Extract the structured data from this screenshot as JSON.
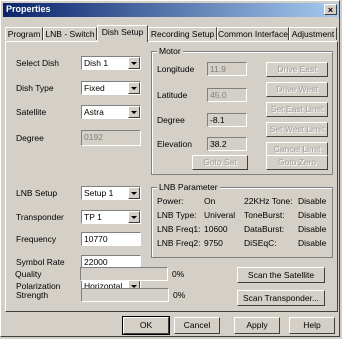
{
  "window": {
    "title": "Properties",
    "close_glyph": "×"
  },
  "tabs": [
    {
      "label": "Program"
    },
    {
      "label": "LNB - Switch"
    },
    {
      "label": "Dish Setup"
    },
    {
      "label": "Recording Setup"
    },
    {
      "label": "Common Interface"
    },
    {
      "label": "Adjustment"
    }
  ],
  "left": {
    "select_dish": {
      "label": "Select Dish",
      "value": "Dish 1"
    },
    "dish_type": {
      "label": "Dish Type",
      "value": "Fixed"
    },
    "satellite": {
      "label": "Satellite",
      "value": "Astra"
    },
    "degree": {
      "label": "Degree",
      "value": "0192"
    },
    "lnb_setup": {
      "label": "LNB Setup",
      "value": "Setup 1"
    },
    "transponder": {
      "label": "Transponder",
      "value": "TP 1"
    },
    "frequency": {
      "label": "Frequency",
      "value": "10770"
    },
    "symbol_rate": {
      "label": "Symbol Rate",
      "value": "22000"
    },
    "polarization": {
      "label": "Polarization",
      "value": "Horizontal"
    }
  },
  "motor": {
    "title": "Motor",
    "longitude": {
      "label": "Longitude",
      "value": "11.9"
    },
    "latitude": {
      "label": "Latitude",
      "value": "45.0"
    },
    "degree": {
      "label": "Degree",
      "value": "-8.1"
    },
    "elevation": {
      "label": "Elevation",
      "value": "38.2"
    },
    "drive_east": "Drive East",
    "drive_west": "Drive West",
    "set_east_limit": "Set East Limit",
    "set_west_limit": "Set West Limit",
    "cancel_limit": "Cancel Limit",
    "goto_sat": "Goto Sat",
    "goto_zero": "Goto Zero"
  },
  "lnb_param": {
    "title": "LNB Parameter",
    "rows": [
      {
        "k1": "Power:",
        "v1": "On",
        "k2": "22KHz Tone:",
        "v2": "Disable"
      },
      {
        "k1": "LNB Type:",
        "v1": "Univeral",
        "k2": "ToneBurst:",
        "v2": "Disable"
      },
      {
        "k1": "LNB Freq1:",
        "v1": "10600",
        "k2": "DataBurst:",
        "v2": "Disable"
      },
      {
        "k1": "LNB Freq2:",
        "v1": "9750",
        "k2": "DiSEqC:",
        "v2": "Disable"
      }
    ]
  },
  "signal": {
    "strength": {
      "label": "Strength",
      "percent": "0%",
      "level": 0
    },
    "quality": {
      "label": "Quality",
      "percent": "0%",
      "level": 0
    },
    "scan_satellite": "Scan the Satellite",
    "scan_transponder": "Scan Transponder..."
  },
  "footer": {
    "ok": "OK",
    "cancel": "Cancel",
    "apply": "Apply",
    "help": "Help"
  }
}
